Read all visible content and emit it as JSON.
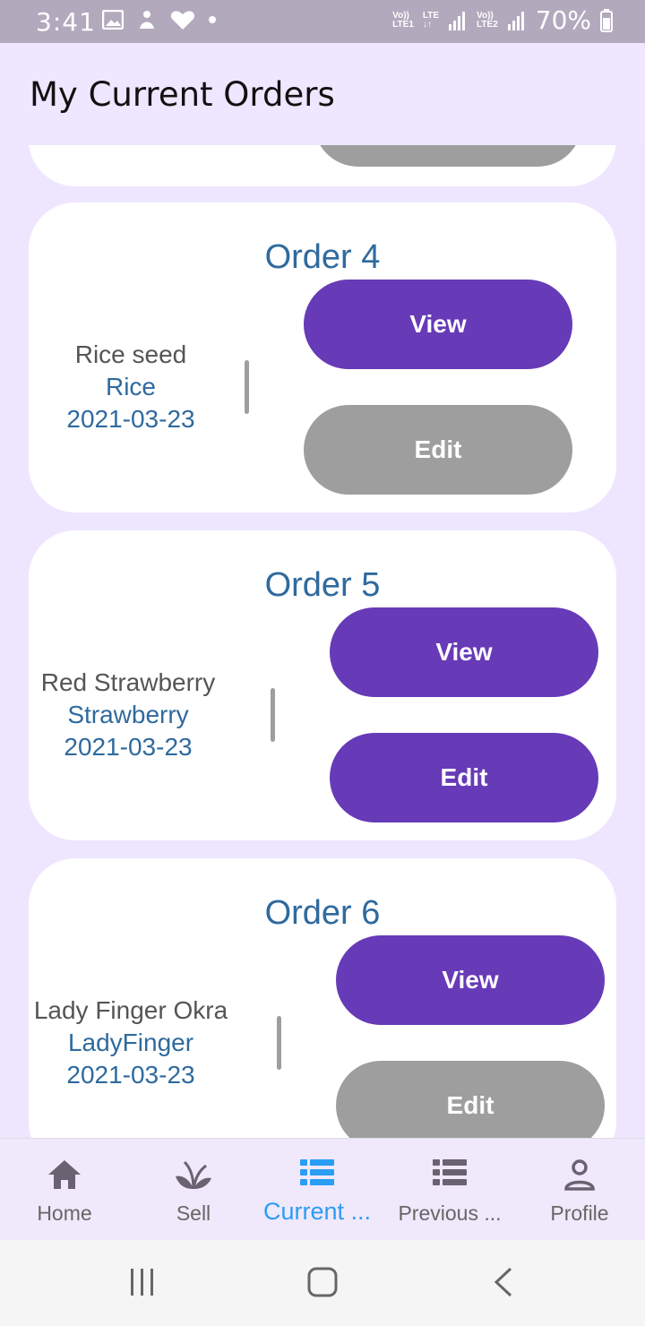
{
  "status": {
    "time": "3:41",
    "battery": "70%",
    "sim1_top": "Vo))",
    "sim1_bottom": "LTE1",
    "lte": "LTE",
    "sim2_top": "Vo))",
    "sim2_bottom": "LTE2"
  },
  "appbar": {
    "title": "My Current Orders"
  },
  "orders": [
    {
      "title": "Order 4",
      "name": "Rice seed",
      "category": "Rice",
      "date": "2021-03-23",
      "view_label": "View",
      "edit_label": "Edit",
      "edit_state": "disabled"
    },
    {
      "title": "Order 5",
      "name": "Red Strawberry",
      "category": "Strawberry",
      "date": "2021-03-23",
      "view_label": "View",
      "edit_label": "Edit",
      "edit_state": "enabled"
    },
    {
      "title": "Order 6",
      "name": "Lady Finger Okra",
      "category": "LadyFinger",
      "date": "2021-03-23",
      "view_label": "View",
      "edit_label": "Edit",
      "edit_state": "disabled"
    }
  ],
  "nav": [
    {
      "label": "Home",
      "icon": "home-icon"
    },
    {
      "label": "Sell",
      "icon": "sprout-icon"
    },
    {
      "label": "Current ...",
      "icon": "list-icon",
      "active": true
    },
    {
      "label": "Previous ...",
      "icon": "list-icon"
    },
    {
      "label": "Profile",
      "icon": "person-icon"
    }
  ],
  "colors": {
    "accent_purple": "#673ab7",
    "disabled_grey": "#9e9e9e",
    "title_blue": "#2f6a9e",
    "active_nav": "#2a9df4",
    "background": "#eee6ff"
  }
}
